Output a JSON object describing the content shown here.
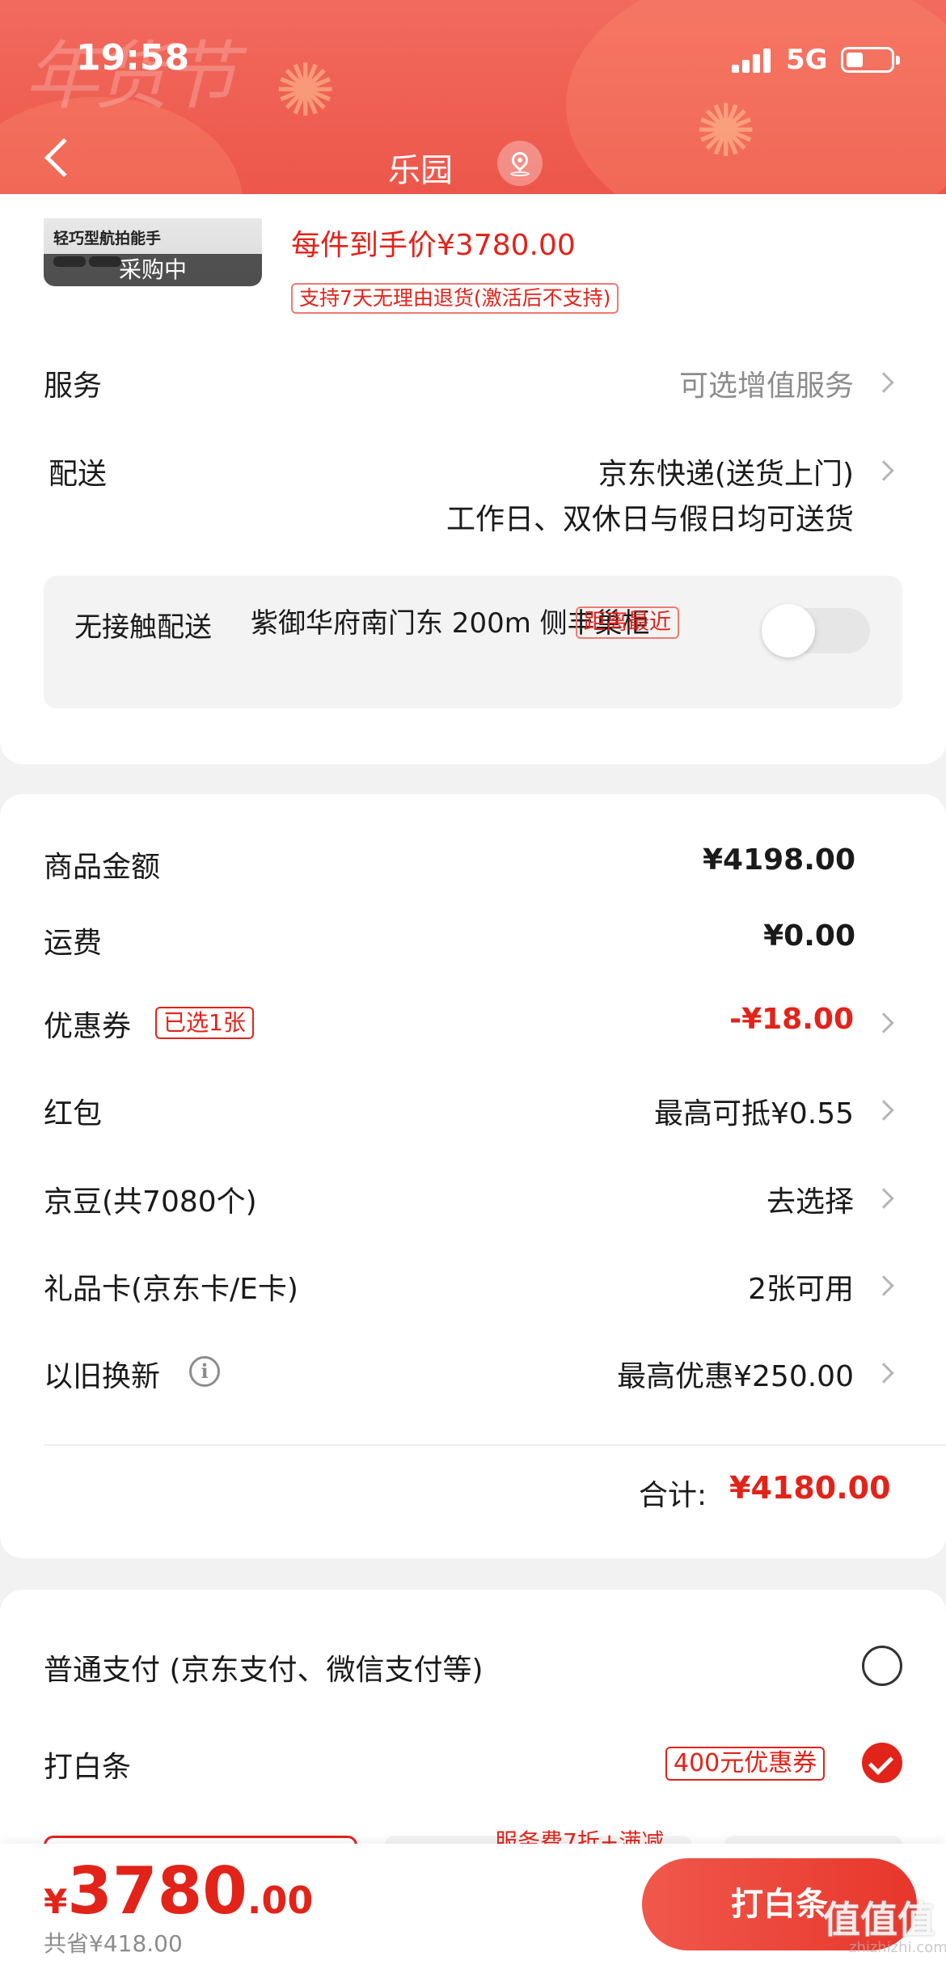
{
  "status_bar": {
    "time": "19:58",
    "network": "5G"
  },
  "header": {
    "festival_text": "年货节",
    "title": "乐园",
    "colors": {
      "header_bg": "#ec5448",
      "accent": "#e2231a"
    }
  },
  "product": {
    "name": "轻巧型航拍能手",
    "status": "采购中",
    "price_line": "每件到手价¥3780.00",
    "return_policy": "支持7天无理由退货(激活后不支持)"
  },
  "service": {
    "label": "服务",
    "value": "可选增值服务"
  },
  "delivery": {
    "label": "配送",
    "method": "京东快递(送货上门)",
    "schedule": "工作日、双休日与假日均可送货"
  },
  "contactless": {
    "label": "无接触配送",
    "address": "紫御华府南门东 200m 侧丰巢柜",
    "tag": "距离最近",
    "enabled": false
  },
  "summary": {
    "goods_label": "商品金额",
    "goods_value": "¥4198.00",
    "shipping_label": "运费",
    "shipping_value": "¥0.00",
    "coupon_label": "优惠券",
    "coupon_tag": "已选1张",
    "coupon_value": "-¥18.00",
    "redpacket_label": "红包",
    "redpacket_value": "最高可抵¥0.55",
    "jingdou_label": "京豆(共7080个)",
    "jingdou_value": "去选择",
    "giftcard_label": "礼品卡(京东卡/E卡)",
    "giftcard_value": "2张可用",
    "tradein_label": "以旧换新",
    "tradein_value": "最高优惠¥250.00",
    "total_label": "合计:",
    "total_value": "¥4180.00"
  },
  "payment": {
    "normal_label": "普通支付 (京东支付、微信支付等)",
    "normal_selected": false,
    "baitiao_label": "打白条",
    "baitiao_coupon": "400元优惠券",
    "baitiao_selected": true,
    "promo_text": "服务费7折+满减"
  },
  "bottom": {
    "currency": "¥",
    "price_int": "3780",
    "price_dec": ".00",
    "saved": "共省¥418.00",
    "button": "打白条"
  },
  "watermark": {
    "main": "值值值",
    "sub": "zhizhizhi.com"
  }
}
